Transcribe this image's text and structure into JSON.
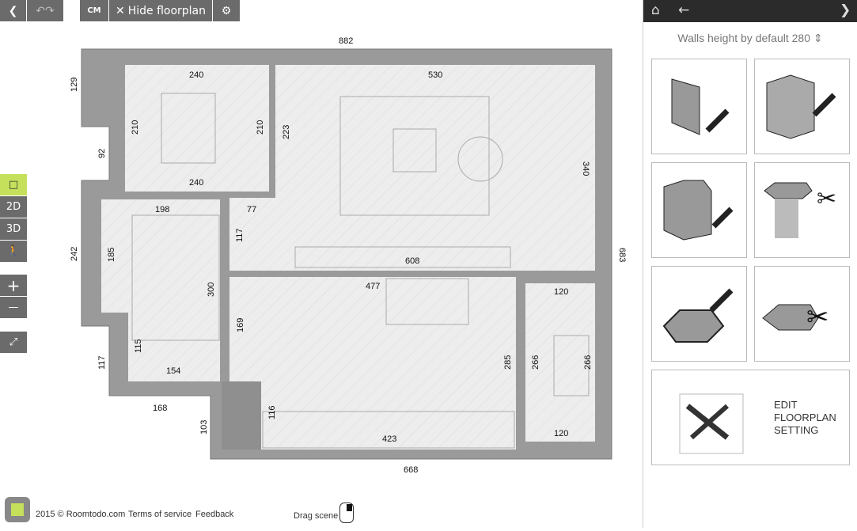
{
  "toolbar": {
    "back_icon": "chevron-left-icon",
    "undo_redo_icon": "undo-redo-icon",
    "units_label": "CM",
    "hide_floorplan_label": "Hide floorplan",
    "settings_icon": "gear-icon"
  },
  "left_tools": {
    "select_icon": "square-select-icon",
    "mode_2d": "2D",
    "mode_3d": "3D",
    "walk_icon": "walk-icon",
    "zoom_in": "+",
    "zoom_out": "—",
    "fit_icon": "fit-arrows-icon"
  },
  "floorplan": {
    "dimensions": [
      "882",
      "129",
      "92",
      "242",
      "117",
      "103",
      "168",
      "668",
      "683",
      "240",
      "210",
      "210",
      "240",
      "223",
      "530",
      "340",
      "198",
      "77",
      "117",
      "185",
      "300",
      "608",
      "477",
      "169",
      "115",
      "154",
      "116",
      "423",
      "285",
      "266",
      "266",
      "120",
      "120"
    ]
  },
  "panel": {
    "home_icon": "home-icon",
    "back_icon": "arrow-left-icon",
    "next_icon": "chevron-right-icon",
    "walls_height_label": "Walls height by default 280",
    "stepper_icon": "up-down-icon",
    "tools": [
      "draw-wall-icon",
      "draw-room-icon",
      "draw-column-icon",
      "cut-column-icon",
      "draw-floor-icon",
      "cut-floor-icon"
    ],
    "edit_setting_label": "EDIT FLOORPLAN SETTING"
  },
  "footer": {
    "copyright": "2015 © Roomtodo.com",
    "terms": "Terms of service",
    "feedback": "Feedback",
    "drag_scene": "Drag scene"
  },
  "colors": {
    "wall": "#9a9a9a",
    "toolbar": "#6b6b6b",
    "active_tool": "#c5e05a",
    "panel_header": "#2b2b2b"
  }
}
